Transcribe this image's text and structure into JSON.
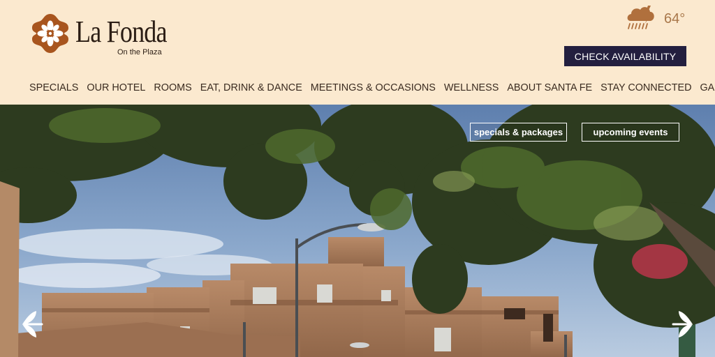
{
  "brand": {
    "name": "La Fonda",
    "tagline": "On the Plaza",
    "accent_color": "#a8551e"
  },
  "weather": {
    "icon": "rain-cloud-lightning-icon",
    "temperature": "64°"
  },
  "header": {
    "check_availability": "CHECK AVAILABILITY"
  },
  "nav": {
    "items": [
      "SPECIALS",
      "OUR HOTEL",
      "ROOMS",
      "EAT, DRINK & DANCE",
      "MEETINGS & OCCASIONS",
      "WELLNESS",
      "ABOUT SANTA FE",
      "STAY CONNECTED",
      "GALLERY"
    ]
  },
  "hero": {
    "buttons": {
      "specials": "specials & packages",
      "events": "upcoming events"
    },
    "prev_icon": "chevron-left-icon",
    "next_icon": "chevron-right-icon"
  },
  "colors": {
    "header_bg": "#fbe9cf",
    "button_bg": "#231f3f"
  }
}
